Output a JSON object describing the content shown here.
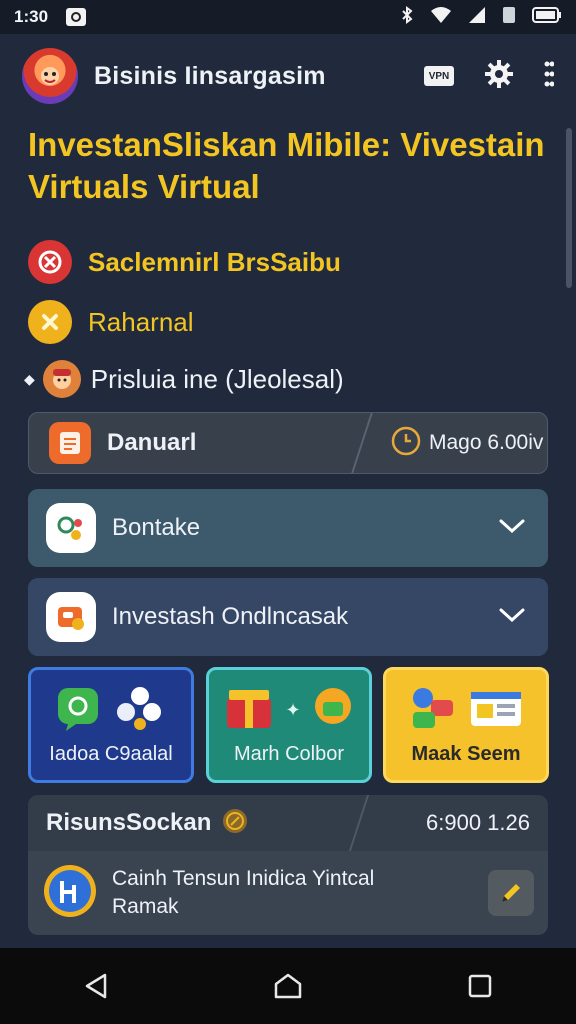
{
  "status_bar": {
    "time": "1:30"
  },
  "app_bar": {
    "title": "Bisinis Iinsargasim",
    "vpn_badge": "VPN"
  },
  "headline": "InvestanSliskan Mibile: Vivestain Virtuals Virtual",
  "info_rows": [
    {
      "label": "Saclemnirl BrsSaibu",
      "color": "#f3c523",
      "icon": "red-target-icon"
    },
    {
      "label": "Raharnal",
      "color": "#f3c523",
      "icon": "yellow-x-icon"
    },
    {
      "label": "Prisluia ine (Jleolesal)",
      "color": "#eef2f7",
      "icon": "avatar-icon"
    }
  ],
  "summary_card": {
    "label": "Danuarl",
    "value": "Mago 6.00iv"
  },
  "accordions": [
    {
      "label": "Bontake"
    },
    {
      "label": "Investash Ondlncasak"
    }
  ],
  "tiles": [
    {
      "label": "Iadoa C9aalal"
    },
    {
      "label": "Marh Colbor"
    },
    {
      "label": "Maak Seem"
    }
  ],
  "bottom_card": {
    "title": "RisunsSockan",
    "value": "6:900 1.26",
    "description_line1": "Cainh Tensun Inidica Yintcal",
    "description_line2": "Ramak"
  },
  "colors": {
    "accent_yellow": "#f3c523",
    "background": "#202a3c"
  }
}
